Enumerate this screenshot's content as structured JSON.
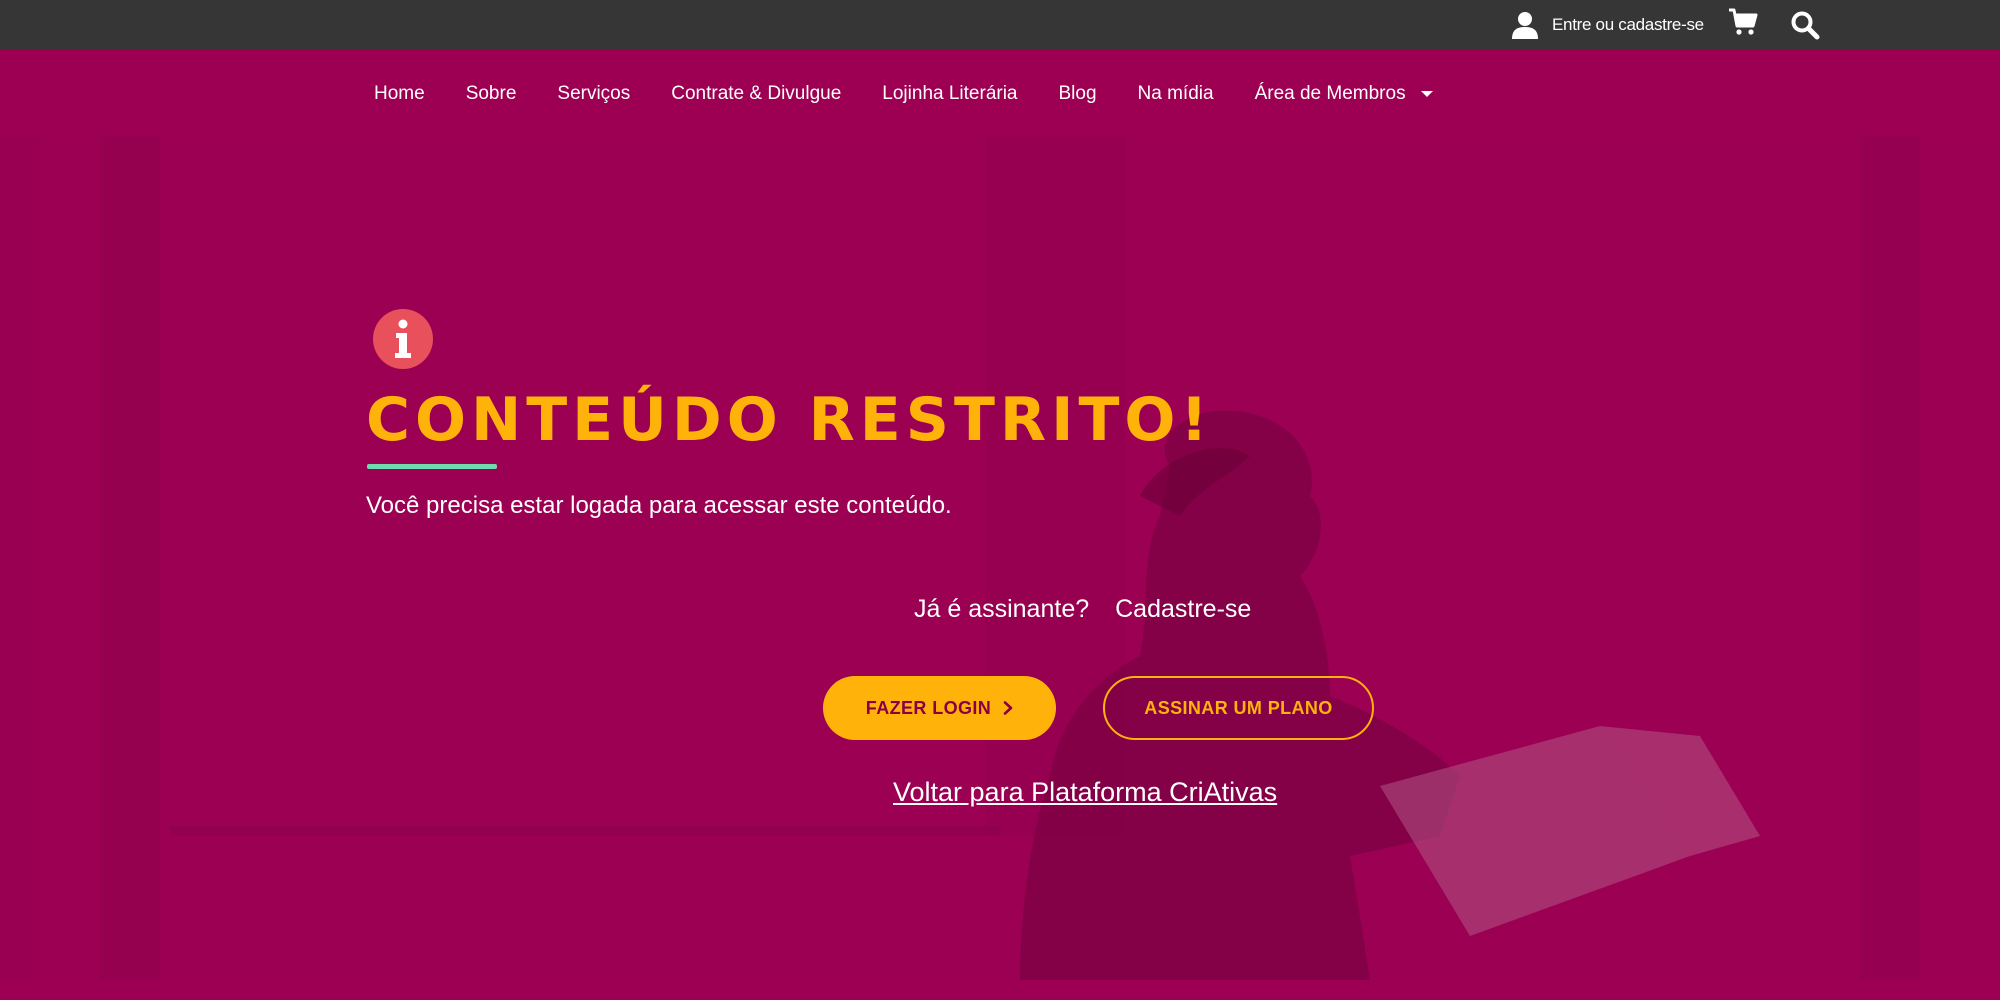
{
  "topbar": {
    "account_label": "Entre ou cadastre-se",
    "icons": [
      "user-icon",
      "cart-icon",
      "search-icon"
    ]
  },
  "nav": {
    "items": [
      {
        "label": "Home"
      },
      {
        "label": "Sobre"
      },
      {
        "label": "Serviços"
      },
      {
        "label": "Contrate & Divulgue"
      },
      {
        "label": "Lojinha Literária"
      },
      {
        "label": "Blog"
      },
      {
        "label": "Na mídia"
      },
      {
        "label": "Área de Membros"
      }
    ]
  },
  "notice": {
    "icon": "info-icon",
    "title": "CONTEÚDO RESTRITO!",
    "message": "Você precisa estar logada para acessar este conteúdo.",
    "already_subscriber": "Já é assinante?",
    "signup": "Cadastre-se",
    "login_button": "FAZER LOGIN",
    "plan_button": "ASSINAR UM PLANO",
    "back_link": "Voltar para Plataforma CriAtivas"
  },
  "colors": {
    "background": "#9d0052",
    "topbar": "#363636",
    "accent": "#ffb30a",
    "underline": "#6fdcb0",
    "info_icon": "#e8505b"
  }
}
